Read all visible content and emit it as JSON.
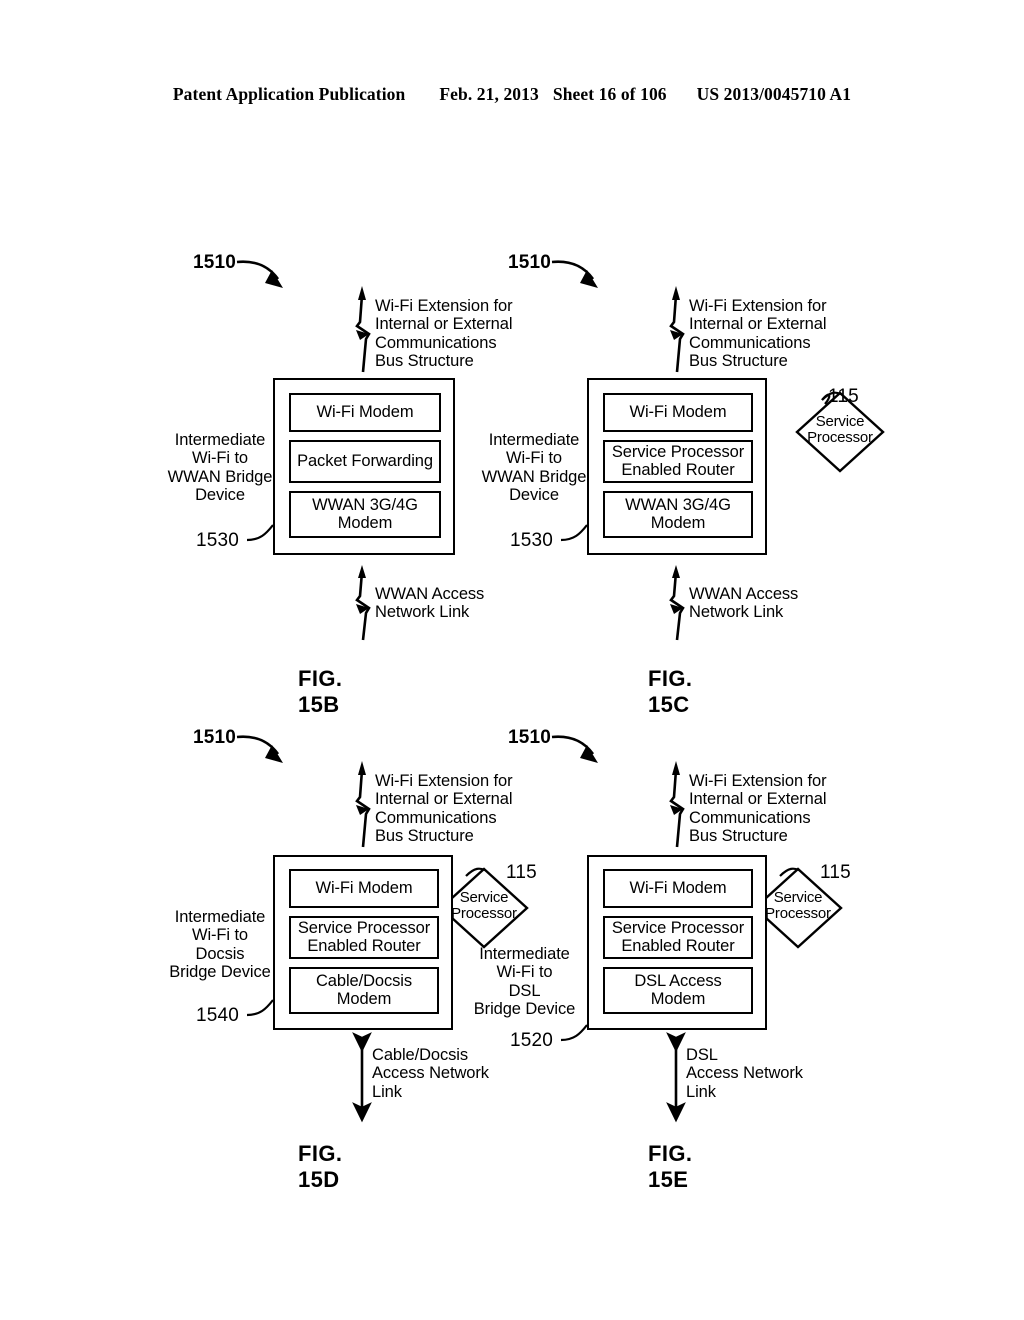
{
  "header": {
    "publication": "Patent Application Publication",
    "date": "Feb. 21, 2013",
    "sheet": "Sheet 16 of 106",
    "patent_number": "US 2013/0045710 A1"
  },
  "figures": [
    {
      "id": "fig-15b",
      "caption": "FIG. 15B",
      "top_ref": "1510",
      "top_link_label": "Wi-Fi Extension for\nInternal or External\nCommunications\nBus Structure",
      "side_label": "Intermediate\nWi-Fi to\nWWAN Bridge\nDevice",
      "device_ref": "1530",
      "modules": [
        "Wi-Fi Modem",
        "Packet Forwarding",
        "WWAN 3G/4G\nModem"
      ],
      "bottom_link_label": "WWAN Access\nNetwork Link",
      "bottom_link_type": "lightning",
      "service_processor": null,
      "service_processor_ref": null
    },
    {
      "id": "fig-15c",
      "caption": "FIG. 15C",
      "top_ref": "1510",
      "top_link_label": "Wi-Fi Extension for\nInternal or External\nCommunications\nBus Structure",
      "side_label": "Intermediate\nWi-Fi to\nWWAN Bridge\nDevice",
      "device_ref": "1530",
      "modules": [
        "Wi-Fi Modem",
        "Service Processor\nEnabled Router",
        "WWAN 3G/4G\nModem"
      ],
      "bottom_link_label": "WWAN Access\nNetwork Link",
      "bottom_link_type": "lightning",
      "service_processor": "Service\nProcessor",
      "service_processor_ref": "115"
    },
    {
      "id": "fig-15d",
      "caption": "FIG. 15D",
      "top_ref": "1510",
      "top_link_label": "Wi-Fi Extension for\nInternal or External\nCommunications\nBus Structure",
      "side_label": "Intermediate\nWi-Fi to\nDocsis\nBridge Device",
      "device_ref": "1540",
      "modules": [
        "Wi-Fi Modem",
        "Service Processor\nEnabled Router",
        "Cable/Docsis\nModem"
      ],
      "bottom_link_label": "Cable/Docsis\nAccess Network\nLink",
      "bottom_link_type": "double-arrow",
      "service_processor": "Service\nProcessor",
      "service_processor_ref": "115"
    },
    {
      "id": "fig-15e",
      "caption": "FIG. 15E",
      "top_ref": "1510",
      "top_link_label": "Wi-Fi Extension for\nInternal or External\nCommunications\nBus Structure",
      "side_label": "Intermediate\nWi-Fi to\nDSL\nBridge Device",
      "device_ref": "1520",
      "modules": [
        "Wi-Fi Modem",
        "Service Processor\nEnabled Router",
        "DSL Access\nModem"
      ],
      "bottom_link_label": "DSL\nAccess Network\nLink",
      "bottom_link_type": "double-arrow",
      "service_processor": "Service\nProcessor",
      "service_processor_ref": "115"
    }
  ],
  "colors": {
    "ink": "#000000",
    "paper": "#ffffff"
  }
}
